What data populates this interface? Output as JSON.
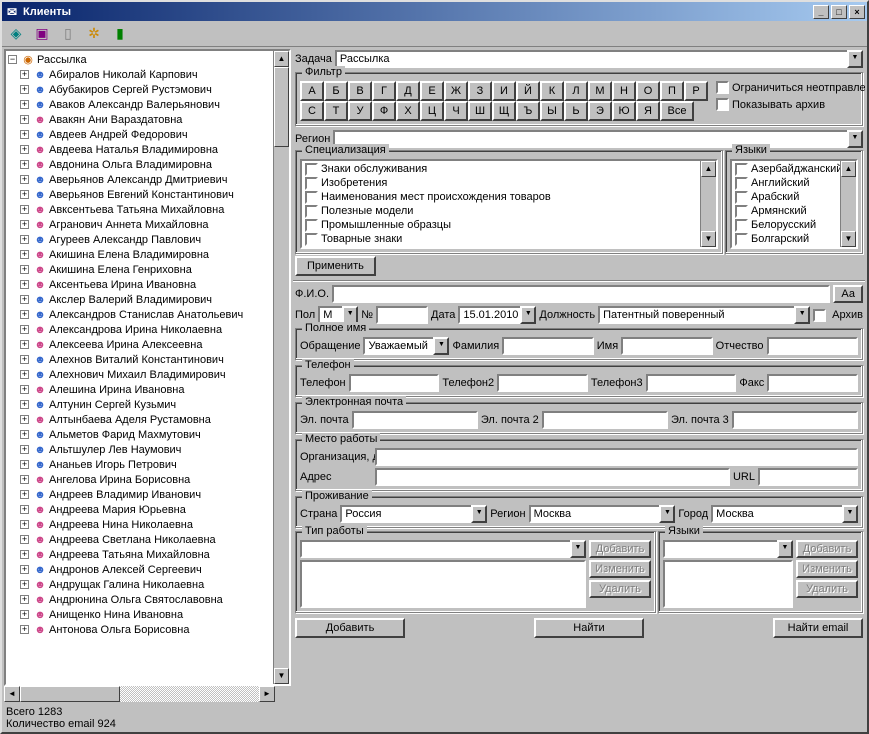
{
  "window": {
    "title": "Клиенты"
  },
  "tree": {
    "root": "Рассылка",
    "items": [
      "Абиралов Николай Карпович",
      "Абубакиров Сергей Рустэмович",
      "Аваков Александр Валерьянович",
      "Авакян Ани Вараздатовна",
      "Авдеев Андрей Федорович",
      "Авдеева Наталья Владимировна",
      "Авдонина Ольга Владимировна",
      "Аверьянов Александр Дмитриевич",
      "Аверьянов Евгений Константинович",
      "Авксентьева Татьяна Михайловна",
      "Агранович Аннета Михайловна",
      "Агуреев Александр Павлович",
      "Акишина Елена Владимировна",
      "Акишина Елена Генриховна",
      "Аксентьева Ирина Ивановна",
      "Акслер Валерий Владимирович",
      "Александров Станислав Анатольевич",
      "Александрова Ирина Николаевна",
      "Алексеева Ирина Алексеевна",
      "Алехнов Виталий Константинович",
      "Алехнович Михаил Владимирович",
      "Алешина Ирина Ивановна",
      "Алтунин Сергей Кузьмич",
      "Алтынбаева Аделя Рустамовна",
      "Альметов Фарид Махмутович",
      "Альтшулер Лев Наумович",
      "Ананьев Игорь Петрович",
      "Ангелова Ирина Борисовна",
      "Андреев Владимир Иванович",
      "Андреева Мария Юрьевна",
      "Андреева Нина Николаевна",
      "Андреева Светлана Николаевна",
      "Андреева Татьяна Михайловна",
      "Андронов Алексей Сергеевич",
      "Андрущак Галина Николаевна",
      "Андрюнина Ольга Святославовна",
      "Анищенко Нина Ивановна",
      "Антонова Ольга Борисовна"
    ]
  },
  "task": {
    "label": "Задача",
    "value": "Рассылка"
  },
  "filter": {
    "legend": "Фильтр",
    "row1": [
      "А",
      "Б",
      "В",
      "Г",
      "Д",
      "Е",
      "Ж",
      "З",
      "И",
      "Й",
      "К",
      "Л",
      "М",
      "Н",
      "О",
      "П",
      "Р"
    ],
    "row2": [
      "С",
      "Т",
      "У",
      "Ф",
      "Х",
      "Ц",
      "Ч",
      "Ш",
      "Щ",
      "Ъ",
      "Ы",
      "Ь",
      "Э",
      "Ю",
      "Я",
      "Все"
    ],
    "opt_unsent": "Ограничиться неотправленным",
    "opt_archive": "Показывать архив"
  },
  "region": {
    "label": "Регион"
  },
  "spec": {
    "legend": "Специализация",
    "items": [
      "Знаки обслуживания",
      "Изобретения",
      "Наименования мест происхождения товаров",
      "Полезные модели",
      "Промышленные образцы",
      "Товарные знаки"
    ]
  },
  "lang": {
    "legend": "Языки",
    "items": [
      "Азербайджанский",
      "Английский",
      "Арабский",
      "Армянский",
      "Белорусский",
      "Болгарский"
    ]
  },
  "apply": "Применить",
  "fio": {
    "label": "Ф.И.О.",
    "btn": "Аа"
  },
  "gender": {
    "label": "Пол",
    "value": "М"
  },
  "num": {
    "label": "№"
  },
  "date": {
    "label": "Дата",
    "value": "15.01.2010"
  },
  "position": {
    "label": "Должность",
    "value": "Патентный поверенный"
  },
  "archive_chk": "Архив",
  "fullname": {
    "legend": "Полное имя",
    "greeting_label": "Обращение",
    "greeting_value": "Уважаемый",
    "lastname": "Фамилия",
    "firstname": "Имя",
    "patronymic": "Отчество"
  },
  "phone": {
    "legend": "Телефон",
    "p1": "Телефон",
    "p2": "Телефон2",
    "p3": "Телефон3",
    "fax": "Факс"
  },
  "email": {
    "legend": "Электронная почта",
    "e1": "Эл. почта",
    "e2": "Эл. почта 2",
    "e3": "Эл. почта 3"
  },
  "work": {
    "legend": "Место работы",
    "org": "Организация, должность",
    "addr": "Адрес",
    "url": "URL"
  },
  "live": {
    "legend": "Проживание",
    "country_label": "Страна",
    "country_value": "Россия",
    "region_label": "Регион",
    "region_value": "Москва",
    "city_label": "Город",
    "city_value": "Москва"
  },
  "worktype": {
    "legend": "Тип работы"
  },
  "langs2": {
    "legend": "Языки"
  },
  "btns": {
    "add": "Добавить",
    "edit": "Изменить",
    "del": "Удалить",
    "find": "Найти",
    "find_email": "Найти email"
  },
  "status": {
    "total": "Всего 1283",
    "emails": "Количество email   924"
  }
}
